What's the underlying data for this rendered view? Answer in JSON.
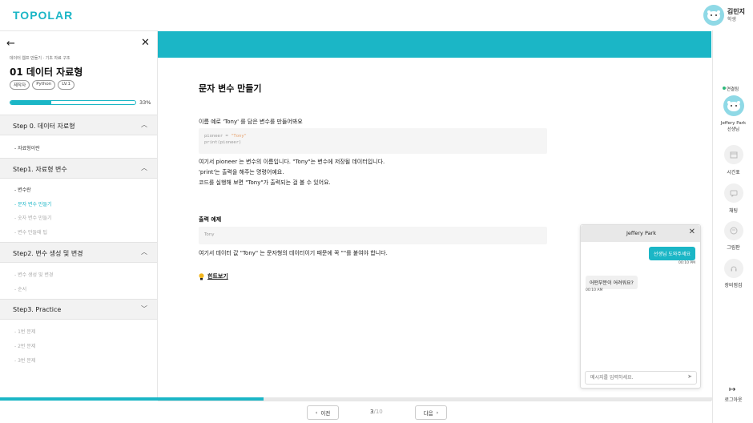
{
  "header": {
    "logo": "TOPOLAR",
    "user_name": "김민지",
    "user_role": "학생"
  },
  "sidebar": {
    "breadcrumb": "데이터 웹프 만들기 · 기초 자료 구조",
    "lesson_title": "01 데이터 자료형",
    "tags": [
      "제작자",
      "Python",
      "LV.1"
    ],
    "progress": 0.33,
    "progress_text": "33%",
    "steps": [
      {
        "label": "Step 0. 데이터 자료형",
        "expanded": true,
        "items": [
          {
            "label": "- 자료형이란",
            "state": "dark"
          }
        ]
      },
      {
        "label": "Step1. 자료형 변수",
        "expanded": true,
        "items": [
          {
            "label": "- 변수란",
            "state": "dark"
          },
          {
            "label": "- 문자 변수 만들기",
            "state": "active"
          },
          {
            "label": "- 숫자 변수 만들기",
            "state": "muted"
          },
          {
            "label": "- 변수 만들때 팁",
            "state": "muted"
          }
        ]
      },
      {
        "label": "Step2. 변수 생성 및 변경",
        "expanded": true,
        "items": [
          {
            "label": "- 변수 생성 및 변경",
            "state": "muted"
          },
          {
            "label": "- 순서",
            "state": "muted"
          }
        ]
      },
      {
        "label": "Step3. Practice",
        "expanded": false,
        "items": [
          {
            "label": "- 1번 문제",
            "state": "muted"
          },
          {
            "label": "- 2번 문제",
            "state": "muted"
          },
          {
            "label": "- 3번 문제",
            "state": "muted"
          }
        ]
      }
    ]
  },
  "content": {
    "title": "문자 변수 만들기",
    "intro": "이름 예로 'Tony' 를 담은 변수를 만들어봐요",
    "code_line1_prefix": "pioneer = ",
    "code_line1_string": "\"Tony\"",
    "code_line2": "print(pioneer)",
    "explain1": "여기서 pioneer 는 변수의 이름입니다. \"Tony\"는 변수에 저장될 데이터입니다.",
    "explain2": "'print'는 출력을 해주는 명령어예요.",
    "explain3": "코드를 실행해 보면 \"Tony\"가 출력되는 걸 볼 수 있어요.",
    "output_title": "출력 예제",
    "output_value": "Tony",
    "note": "여기서 데이터 값 \"Tony\" 는 문자형의 데이터이기 때문에 꼭 \"\"를 붙여야 합니다.",
    "hint_label": "힌트보기"
  },
  "pager": {
    "prev_label": "이전",
    "next_label": "다음",
    "current": "3",
    "total": "/10"
  },
  "page_progress": 0.35,
  "rail": {
    "status": "연결됨",
    "teacher_name": "Jeffery Park",
    "teacher_role": "선생님",
    "buttons": [
      {
        "label": "시간표",
        "icon": "calendar-icon"
      },
      {
        "label": "채팅",
        "icon": "chat-icon"
      },
      {
        "label": "그림판",
        "icon": "palette-icon"
      },
      {
        "label": "장비점검",
        "icon": "headset-icon"
      }
    ],
    "logout": "로그아웃"
  },
  "chat": {
    "title": "Jeffery Park",
    "my_message": "선생님 도와주세요",
    "my_time": "00:10 PM",
    "their_message": "어떤부분이 어려워요?",
    "their_time": "00:10 AM",
    "placeholder": "메시지를 입력하세요."
  },
  "colors": {
    "accent": "#1bb6c6",
    "status": "#2db87a"
  }
}
